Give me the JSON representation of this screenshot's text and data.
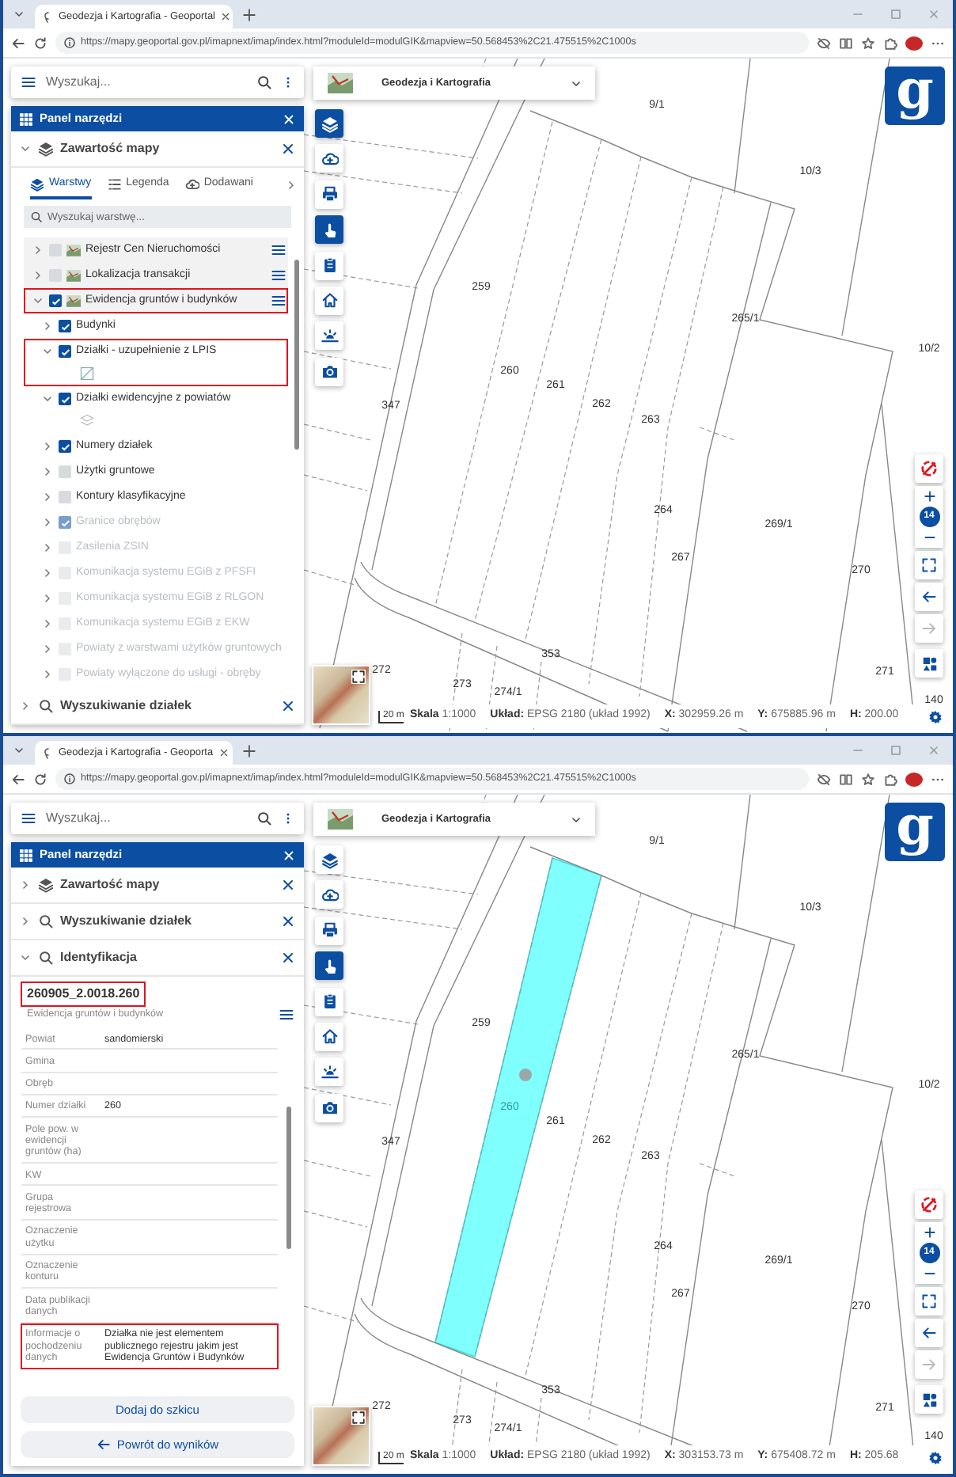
{
  "windows": [
    {
      "tab_title": "Geodezja i Kartografia - Geoportal",
      "url": "https://mapy.geoportal.gov.pl/imapnext/imap/index.html?moduleId=modulGIK&mapview=50.568453%2C21.475515%2C1000s",
      "search": {
        "placeholder": "Wyszukaj..."
      },
      "panel": {
        "title": "Panel narzędzi",
        "sections": [
          {
            "kind": "layers",
            "title": "Zawartość mapy",
            "expanded": true,
            "tabs": [
              {
                "label": "Warstwy",
                "selected": true
              },
              {
                "label": "Legenda",
                "selected": false
              },
              {
                "label": "Dodawani",
                "selected": false
              }
            ],
            "layer_search": {
              "placeholder": "Wyszukaj warstwę..."
            },
            "layers": [
              {
                "label": "Rejestr Cen Nieruchomości",
                "checked": false,
                "expanded": false,
                "disabled": false,
                "highlighted": false
              },
              {
                "label": "Lokalizacja transakcji",
                "checked": false,
                "expanded": false,
                "disabled": false,
                "highlighted": false
              },
              {
                "label": "Ewidencja gruntów i budynków",
                "checked": true,
                "expanded": true,
                "disabled": false,
                "highlighted": true,
                "children": [
                  {
                    "label": "Budynki",
                    "checked": true,
                    "expanded": false,
                    "disabled": false,
                    "highlighted": false
                  },
                  {
                    "label": "Działki - uzupełnienie z LPIS",
                    "checked": true,
                    "expanded": true,
                    "disabled": false,
                    "highlighted": true
                  },
                  {
                    "label": "Działki ewidencyjne z powiatów",
                    "checked": true,
                    "expanded": true,
                    "disabled": false,
                    "highlighted": false
                  },
                  {
                    "label": "Numery działek",
                    "checked": true,
                    "expanded": false,
                    "disabled": false,
                    "highlighted": false
                  },
                  {
                    "label": "Użytki gruntowe",
                    "checked": false,
                    "expanded": false,
                    "disabled": false,
                    "highlighted": false
                  },
                  {
                    "label": "Kontury klasyfikacyjne",
                    "checked": false,
                    "expanded": false,
                    "disabled": false,
                    "highlighted": false
                  },
                  {
                    "label": "Granice obrębów",
                    "checked": true,
                    "expanded": false,
                    "disabled": true,
                    "highlighted": false
                  },
                  {
                    "label": "Zasilenia ZSIN",
                    "checked": false,
                    "expanded": false,
                    "disabled": true,
                    "highlighted": false
                  },
                  {
                    "label": "Komunikacja systemu EGiB z PFSFI",
                    "checked": false,
                    "expanded": false,
                    "disabled": true,
                    "highlighted": false
                  },
                  {
                    "label": "Komunikacja systemu EGiB z RLGON",
                    "checked": false,
                    "expanded": false,
                    "disabled": true,
                    "highlighted": false
                  },
                  {
                    "label": "Komunikacja systemu EGiB z EKW",
                    "checked": false,
                    "expanded": false,
                    "disabled": true,
                    "highlighted": false
                  },
                  {
                    "label": "Powiaty z warstwami użytków gruntowych",
                    "checked": false,
                    "expanded": false,
                    "disabled": true,
                    "highlighted": false
                  },
                  {
                    "label": "Powiaty wyłączone do usługi - obręby",
                    "checked": false,
                    "expanded": false,
                    "disabled": true,
                    "highlighted": false
                  }
                ]
              }
            ]
          },
          {
            "kind": "search",
            "title": "Wyszukiwanie działek",
            "expanded": false
          }
        ]
      },
      "basemap": {
        "title": "Geodezja i Kartografia"
      },
      "logo": "g",
      "tools": [
        {
          "active": true
        },
        {
          "active": false
        },
        {
          "active": false
        },
        {
          "active": true
        },
        {
          "active": false
        },
        {
          "active": false
        },
        {
          "active": false
        },
        {
          "active": false
        }
      ],
      "zoom_level": "14",
      "scale_bar": "20 m",
      "map_labels": [
        {
          "text": "9/1",
          "highlighted": false
        },
        {
          "text": "10/3",
          "highlighted": false
        },
        {
          "text": "259",
          "highlighted": false
        },
        {
          "text": "265/1",
          "highlighted": false
        },
        {
          "text": "10/2",
          "highlighted": false
        },
        {
          "text": "260",
          "highlighted": false
        },
        {
          "text": "261",
          "highlighted": false
        },
        {
          "text": "262",
          "highlighted": false
        },
        {
          "text": "263",
          "highlighted": false
        },
        {
          "text": "347",
          "highlighted": false
        },
        {
          "text": "264",
          "highlighted": false
        },
        {
          "text": "269/1",
          "highlighted": false
        },
        {
          "text": "267",
          "highlighted": false
        },
        {
          "text": "270",
          "highlighted": false
        },
        {
          "text": "353",
          "highlighted": false
        },
        {
          "text": "272",
          "highlighted": false
        },
        {
          "text": "273",
          "highlighted": false
        },
        {
          "text": "274/1",
          "highlighted": false
        },
        {
          "text": "271",
          "highlighted": false
        },
        {
          "text": "140",
          "highlighted": false
        }
      ],
      "status": [
        "**Skala** 1:1000",
        "**Układ:** EPSG 2180 (układ 1992)",
        "**X:** 302959.26 m",
        "**Y:** 675885.96 m",
        "**H:** 200.00"
      ]
    },
    {
      "tab_title": "Geodezja i Kartografia - Geoporta",
      "url": "https://mapy.geoportal.gov.pl/imapnext/imap/index.html?moduleId=modulGIK&mapview=50.568453%2C21.475515%2C1000s",
      "search": {
        "placeholder": "Wyszukaj..."
      },
      "panel": {
        "title": "Panel narzędzi",
        "sections": [
          {
            "kind": "layers",
            "title": "Zawartość mapy",
            "expanded": false
          },
          {
            "kind": "search",
            "title": "Wyszukiwanie działek",
            "expanded": false
          },
          {
            "kind": "identify",
            "title": "Identyfikacja",
            "expanded": true,
            "result": {
              "id": "260905_2.0018.260",
              "id_highlighted": true,
              "layer": "Ewidencja gruntów i budynków",
              "rows": [
                {
                  "label": "Powiat",
                  "value": "sandomierski",
                  "highlighted": false
                },
                {
                  "label": "Gmina",
                  "highlighted": false
                },
                {
                  "label": "Obręb",
                  "highlighted": false
                },
                {
                  "label": "Numer działki",
                  "value": "260",
                  "highlighted": false
                },
                {
                  "label": "Pole pow. w ewidencji gruntów (ha)",
                  "highlighted": false
                },
                {
                  "label": "KW",
                  "highlighted": false
                },
                {
                  "label": "Grupa rejestrowa",
                  "highlighted": false
                },
                {
                  "label": "Oznaczenie użytku",
                  "highlighted": false
                },
                {
                  "label": "Oznaczenie konturu",
                  "highlighted": false
                },
                {
                  "label": "Data publikacji danych",
                  "highlighted": false
                },
                {
                  "label": "Informacje o pochodzeniu danych",
                  "value": "Działka nie jest elementem publicznego rejestru jakim jest Ewidencja Gruntów i Budynków",
                  "highlighted": true
                }
              ],
              "buttons": [
                {
                  "label": "Dodaj do szkicu",
                  "kind": "plain"
                },
                {
                  "label": "Powrót do wyników",
                  "kind": "back"
                }
              ]
            }
          }
        ]
      },
      "basemap": {
        "title": "Geodezja i Kartografia"
      },
      "logo": "g",
      "tools": [
        {
          "active": false
        },
        {
          "active": false
        },
        {
          "active": false
        },
        {
          "active": true
        },
        {
          "active": false
        },
        {
          "active": false
        },
        {
          "active": false
        },
        {
          "active": false
        }
      ],
      "zoom_level": "14",
      "scale_bar": "20 m",
      "map_labels": [
        {
          "text": "9/1",
          "highlighted": false
        },
        {
          "text": "10/3",
          "highlighted": false
        },
        {
          "text": "259",
          "highlighted": false
        },
        {
          "text": "265/1",
          "highlighted": false
        },
        {
          "text": "10/2",
          "highlighted": false
        },
        {
          "text": "260",
          "highlighted": true
        },
        {
          "text": "261",
          "highlighted": false
        },
        {
          "text": "262",
          "highlighted": false
        },
        {
          "text": "263",
          "highlighted": false
        },
        {
          "text": "347",
          "highlighted": false
        },
        {
          "text": "264",
          "highlighted": false
        },
        {
          "text": "269/1",
          "highlighted": false
        },
        {
          "text": "267",
          "highlighted": false
        },
        {
          "text": "270",
          "highlighted": false
        },
        {
          "text": "353",
          "highlighted": false
        },
        {
          "text": "272",
          "highlighted": false
        },
        {
          "text": "273",
          "highlighted": false
        },
        {
          "text": "274/1",
          "highlighted": false
        },
        {
          "text": "271",
          "highlighted": false
        },
        {
          "text": "140",
          "highlighted": false
        }
      ],
      "status": [
        "**Skala** 1:1000",
        "**Układ:** EPSG 2180 (układ 1992)",
        "**X:** 303153.73 m",
        "**Y:** 675408.72 m",
        "**H:** 205.68"
      ]
    }
  ]
}
